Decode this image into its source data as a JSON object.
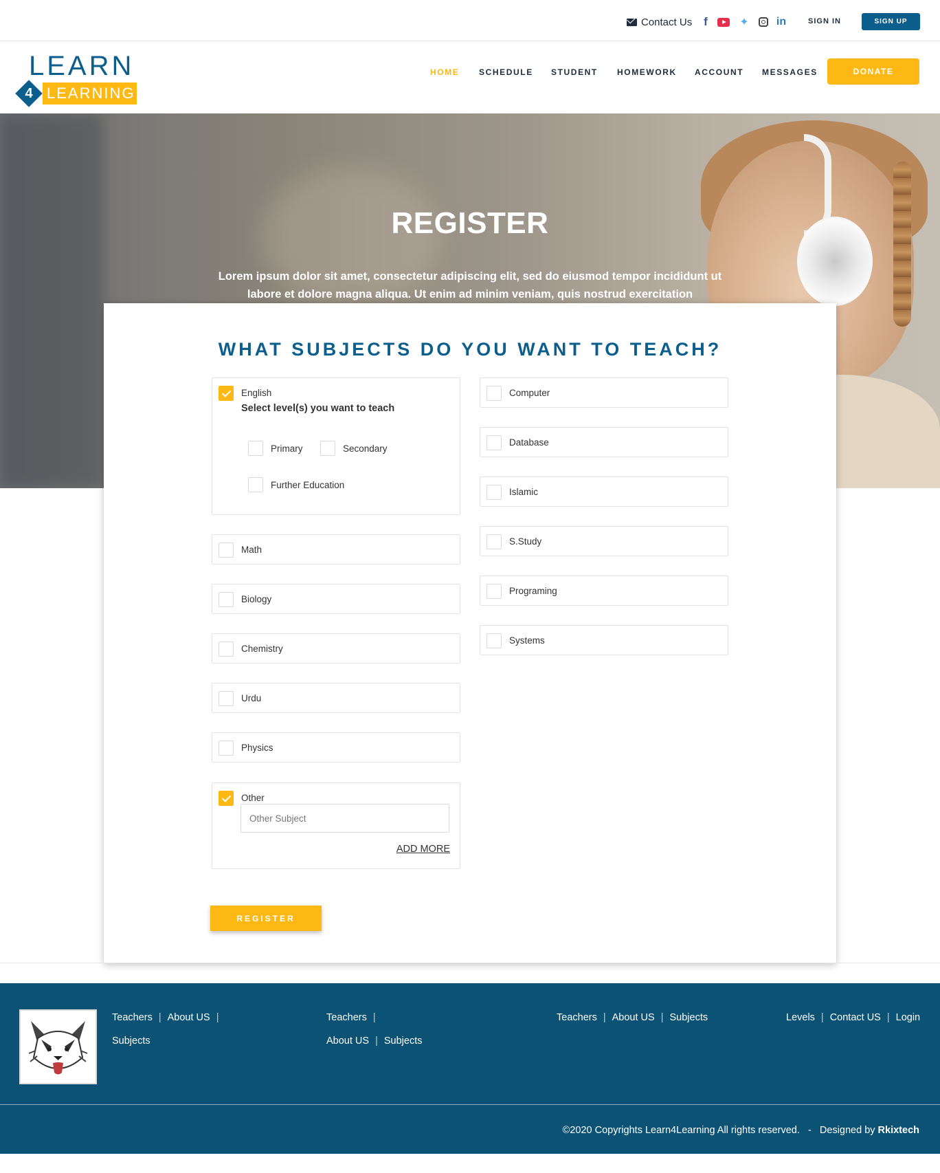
{
  "topbar": {
    "contact": "Contact Us",
    "sign_in": "SIGN IN",
    "sign_up": "SIGN UP"
  },
  "icons": {
    "mail": "envelope-icon",
    "facebook": "facebook-icon",
    "youtube": "youtube-icon",
    "twitter": "twitter-icon",
    "instagram": "instagram-icon",
    "linkedin": "linkedin-icon"
  },
  "logo": {
    "line1": "LEARN",
    "number": "4",
    "line2": "LEARNING"
  },
  "nav": {
    "items": [
      "HOME",
      "SCHEDULE",
      "STUDENT",
      "HOMEWORK",
      "ACCOUNT",
      "MESSAGES"
    ],
    "active": "HOME",
    "donate": "DONATE"
  },
  "hero": {
    "title": "REGISTER",
    "text": "Lorem ipsum dolor sit amet, consectetur adipiscing elit, sed do eiusmod tempor incididunt ut labore et dolore magna aliqua. Ut enim ad minim veniam, quis nostrud exercitation"
  },
  "form": {
    "heading": "WHAT SUBJECTS DO YOU WANT TO TEACH?",
    "english": {
      "label": "English",
      "checked": true,
      "levels_title": "Select level(s) you want to teach",
      "levels": [
        "Primary",
        "Secondary",
        "Further Education"
      ]
    },
    "left_subjects": [
      "Math",
      "Biology",
      "Chemistry",
      "Urdu",
      "Physics"
    ],
    "right_subjects": [
      "Computer",
      "Database",
      "Islamic",
      "S.Study",
      "Programing",
      "Systems"
    ],
    "other": {
      "label": "Other",
      "checked": true,
      "placeholder": "Other Subject",
      "add_more": "ADD MORE"
    },
    "register": "REGISTER"
  },
  "footer": {
    "col1": {
      "row1": [
        "Teachers",
        "About US"
      ],
      "row2": [
        "Subjects"
      ]
    },
    "col2": {
      "row1": [
        "Teachers"
      ],
      "row2": [
        "About US",
        "Subjects"
      ]
    },
    "col3": {
      "row1": [
        "Teachers",
        "About US",
        "Subjects"
      ]
    },
    "col4": {
      "row1": [
        "Levels",
        "Contact US",
        "Login"
      ]
    },
    "copyright": "©2020 Copyrights Learn4Learning All rights reserved.",
    "dash": "-",
    "designed_by": "Designed by",
    "designer": "Rkixtech"
  },
  "colors": {
    "brand_blue": "#0c5f8c",
    "accent_yellow": "#fdb813",
    "footer_blue": "#0b5274"
  }
}
